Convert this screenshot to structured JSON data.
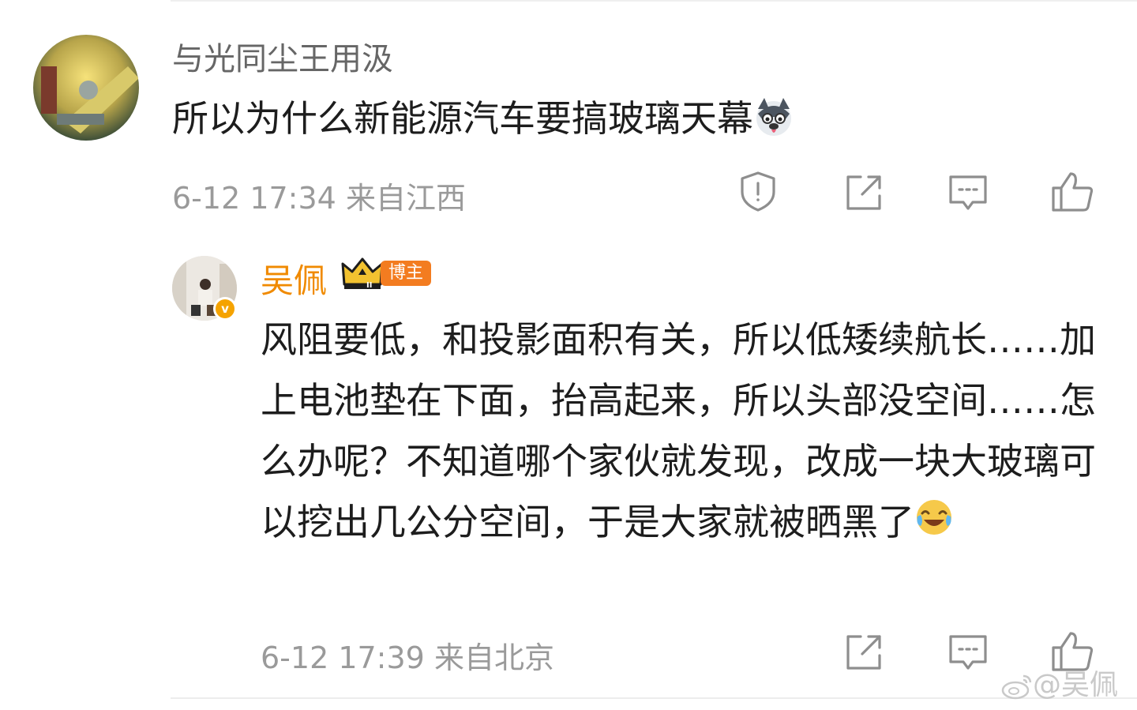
{
  "comment": {
    "username": "与光同尘王用汲",
    "text": "所以为什么新能源汽车要搞玻璃天幕",
    "inline_emoji": "husky-emoji",
    "time": "6-12 17:34",
    "location": "来自江西",
    "actions": [
      "report-icon",
      "share-icon",
      "comment-icon",
      "like-icon"
    ]
  },
  "reply": {
    "username": "吴佩",
    "badge_label": "博主",
    "badge_icon": "crown-icon",
    "verified_icon": "verified-icon",
    "text": "风阻要低，和投影面积有关，所以低矮续航长……加上电池垫在下面，抬高起来，所以头部没空间……怎么办呢？不知道哪个家伙就发现，改成一块大玻璃可以挖出几公分空间，于是大家就被晒黑了",
    "inline_emoji": "laugh-cry-emoji",
    "time": "6-12 17:39",
    "location": "来自北京",
    "actions": [
      "share-icon",
      "comment-icon",
      "like-icon"
    ]
  },
  "watermark": "@吴佩",
  "colors": {
    "username_gray": "#666666",
    "meta_gray": "#9a9a9a",
    "blogger_orange": "#f08a00",
    "badge_orange": "#f37c20"
  }
}
